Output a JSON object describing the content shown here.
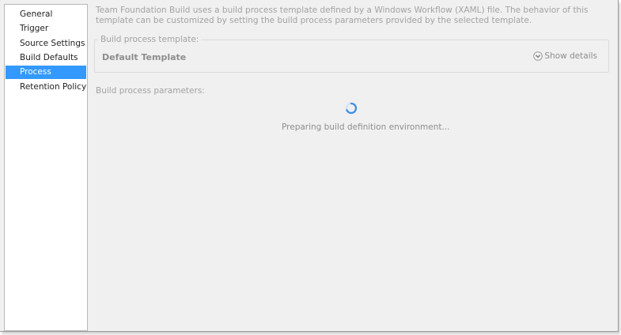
{
  "sidebar": {
    "items": [
      {
        "label": "General"
      },
      {
        "label": "Trigger"
      },
      {
        "label": "Source Settings"
      },
      {
        "label": "Build Defaults"
      },
      {
        "label": "Process",
        "selected": true
      },
      {
        "label": "Retention Policy"
      }
    ]
  },
  "process": {
    "description": "Team Foundation Build uses a build process template defined by a Windows Workflow (XAML) file. The behavior of this template can be customized by setting the build process parameters provided by the selected template.",
    "template_group_label": "Build process template:",
    "template_name": "Default Template",
    "show_details_label": "Show details",
    "parameters_label": "Build process parameters:",
    "loading_text": "Preparing build definition environment..."
  },
  "icons": {
    "show_details": "chevron-down-circle-icon",
    "loading": "spinner-icon"
  },
  "colors": {
    "selection": "#3399ff",
    "panel_background": "#f0f0f0",
    "disabled_text": "#a2a2a2"
  }
}
